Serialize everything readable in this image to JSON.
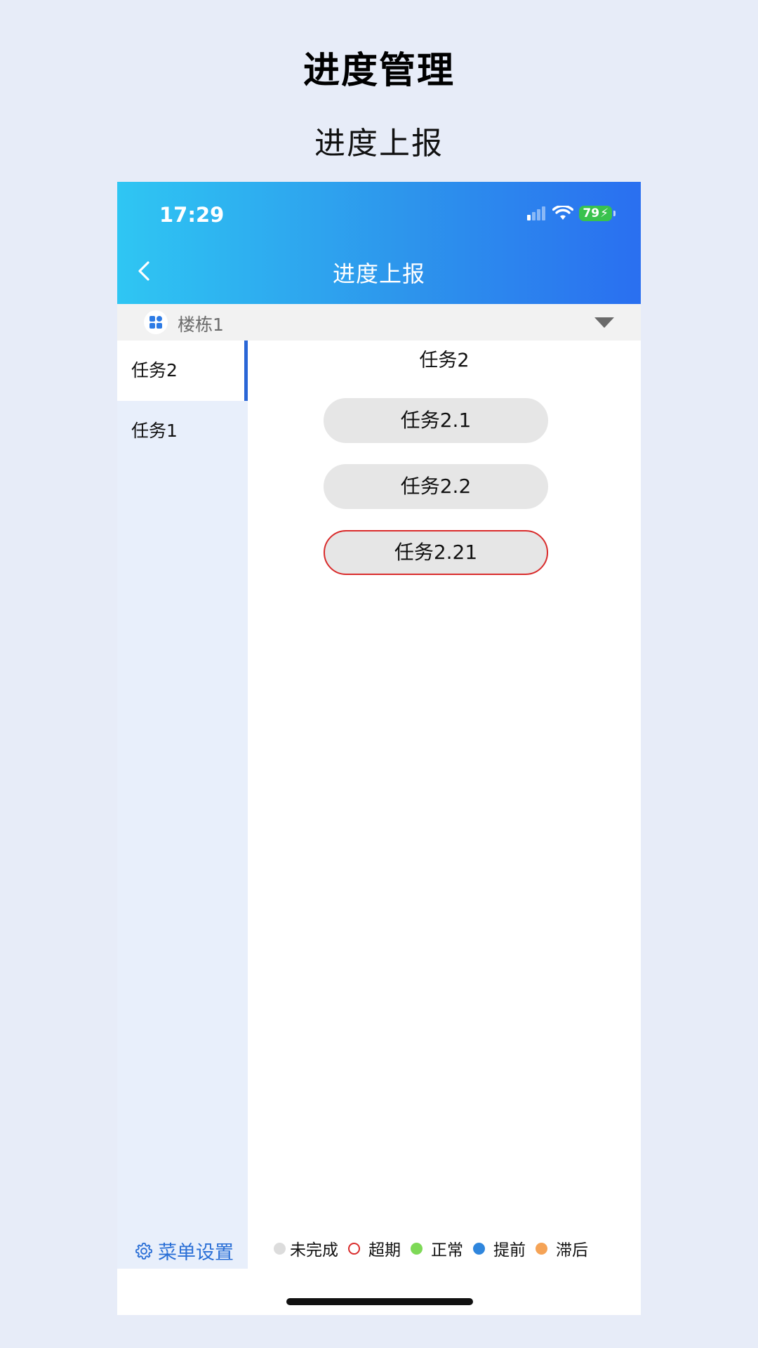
{
  "page": {
    "heading": "进度管理",
    "subheading": "进度上报"
  },
  "status_bar": {
    "time": "17:29",
    "battery": "79"
  },
  "header": {
    "title": "进度上报",
    "back_icon": "chevron-left-icon",
    "gradient_colors": [
      "#2fc6f3",
      "#2a6ff0"
    ]
  },
  "building_selector": {
    "value": "楼栋1",
    "icon": "apps-icon",
    "arrow_icon": "triangle-down-icon"
  },
  "sidebar": {
    "items": [
      {
        "label": "任务2",
        "active": true
      },
      {
        "label": "任务1",
        "active": false
      }
    ],
    "menu_settings_label": "菜单设置",
    "active_color": "#2a66d6"
  },
  "content": {
    "group_title": "任务2",
    "tasks": [
      {
        "label": "任务2.1",
        "status": "未完成"
      },
      {
        "label": "任务2.2",
        "status": "未完成"
      },
      {
        "label": "任务2.21",
        "status": "超期"
      }
    ]
  },
  "legend": [
    {
      "label": "未完成",
      "color": "#dcdcdc",
      "style": "filled"
    },
    {
      "label": "超期",
      "color": "#d92b2b",
      "style": "outline"
    },
    {
      "label": "正常",
      "color": "#7ed957",
      "style": "filled"
    },
    {
      "label": "提前",
      "color": "#2f86dd",
      "style": "filled"
    },
    {
      "label": "滞后",
      "color": "#f5a356",
      "style": "filled"
    }
  ]
}
